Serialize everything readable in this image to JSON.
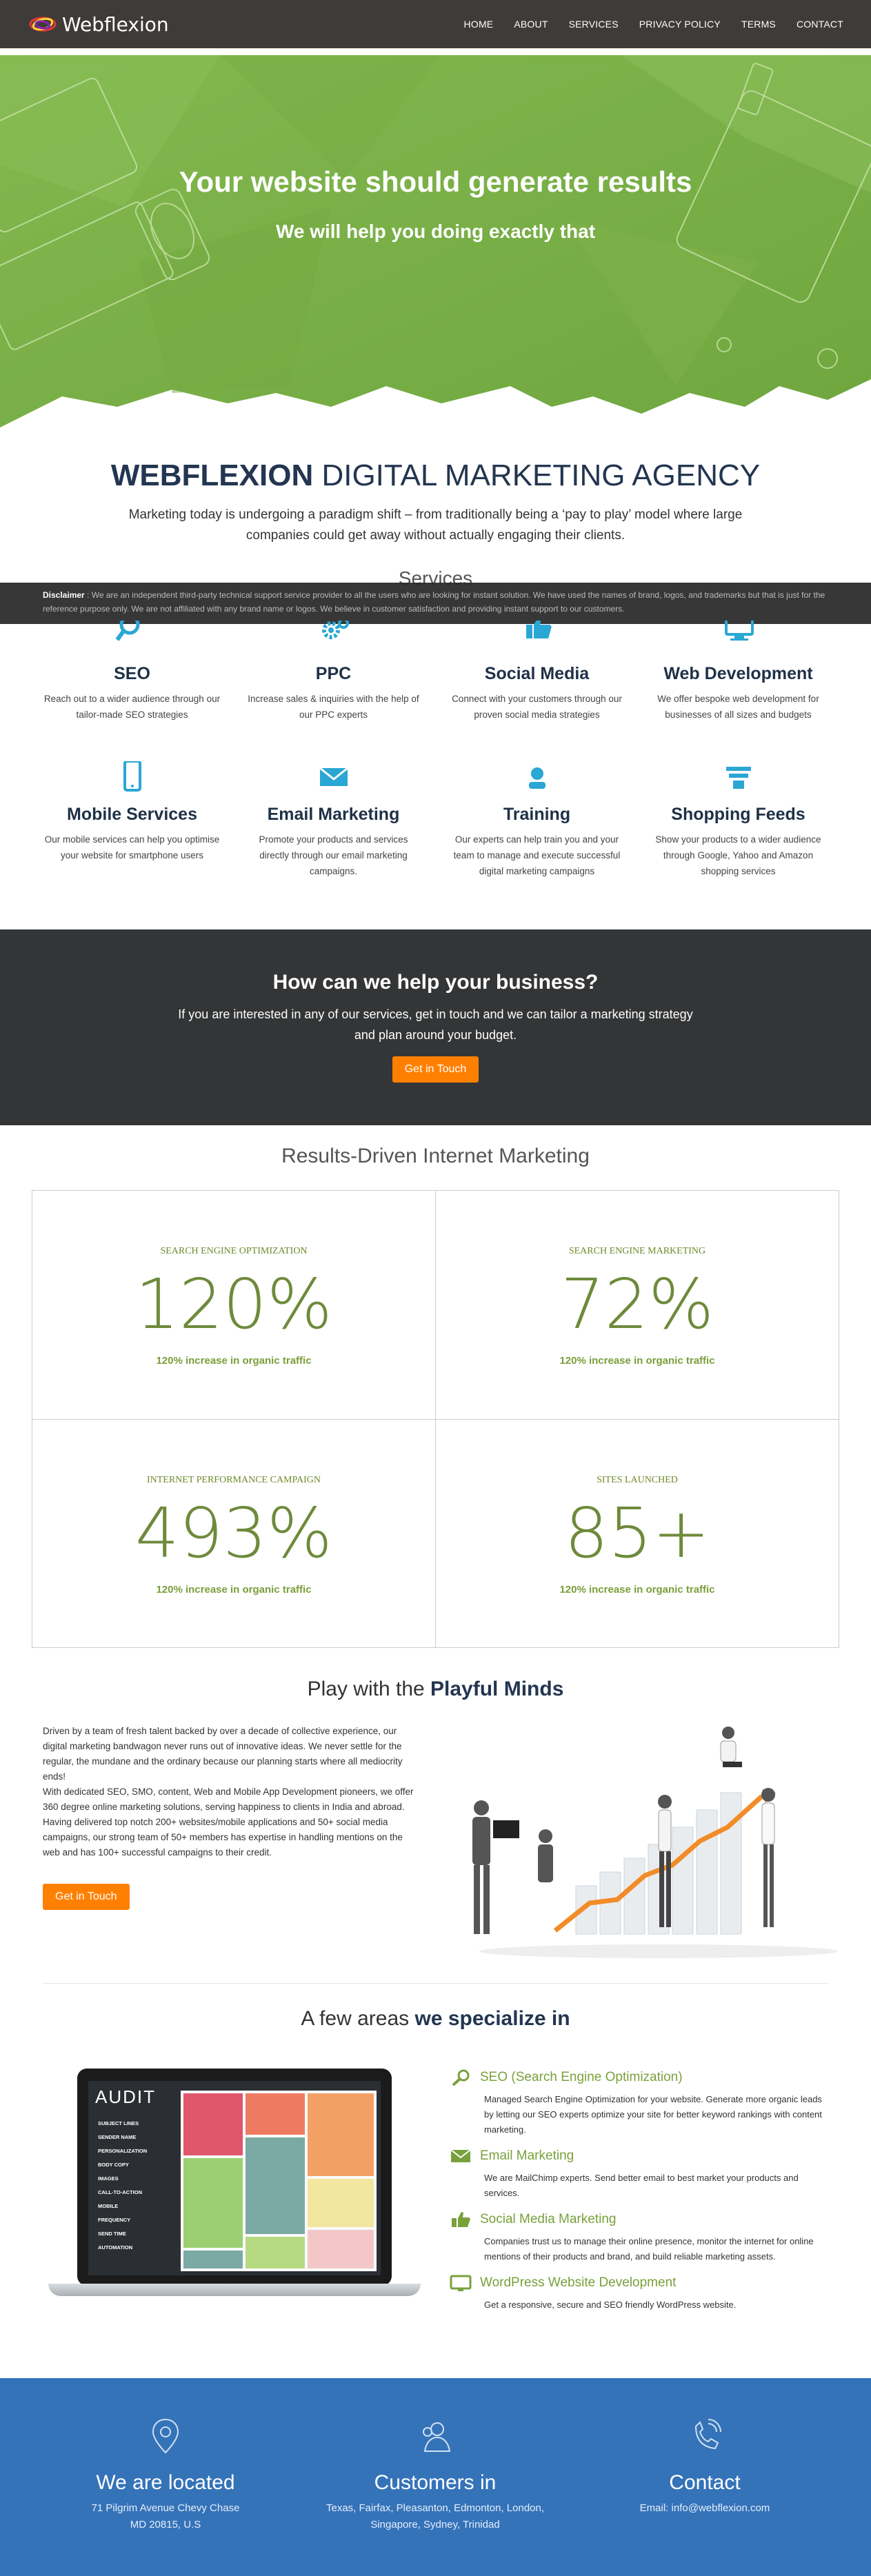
{
  "nav": {
    "brand": "Webflexion",
    "items": [
      {
        "label": "HOME"
      },
      {
        "label": "ABOUT"
      },
      {
        "label": "SERVICES"
      },
      {
        "label": "PRIVACY POLICY"
      },
      {
        "label": "TERMS"
      },
      {
        "label": "CONTACT"
      }
    ]
  },
  "hero": {
    "title": "Your website should generate results",
    "subtitle": "We will help you doing exactly that",
    "color": "#7fb14a"
  },
  "agency": {
    "title_bold": "WEBFLEXION",
    "title_rest": " DIGITAL MARKETING AGENCY",
    "description": "Marketing today is undergoing a paradigm shift – from traditionally being a ‘pay to play’ model where large companies could get away without actually engaging their clients."
  },
  "services_heading": "Services",
  "disclaimer": {
    "label": "Disclaimer",
    "text": " : We are an independent third-party technical support service provider to all the users who are looking for instant solution. We have used the names of brand, logos, and trademarks but that is just for the reference purpose only. We are not affiliated with any brand name or logos. We believe in customer satisfaction and providing instant support to our customers."
  },
  "services": [
    {
      "icon": "magnifier-icon",
      "title": "SEO",
      "text": "Reach out to a wider audience through our tailor-made SEO strategies"
    },
    {
      "icon": "gears-icon",
      "title": "PPC",
      "text": "Increase sales & inquiries with the help of our PPC experts"
    },
    {
      "icon": "thumbs-up-icon",
      "title": "Social Media",
      "text": "Connect with your customers through our proven social media strategies"
    },
    {
      "icon": "monitor-icon",
      "title": "Web Development",
      "text": "We offer bespoke web development for businesses of all sizes and budgets"
    },
    {
      "icon": "mobile-icon",
      "title": "Mobile Services",
      "text": "Our mobile services can help you optimise your website for smartphone users"
    },
    {
      "icon": "envelope-icon",
      "title": "Email Marketing",
      "text": "Promote your products and services directly through our email marketing campaigns."
    },
    {
      "icon": "training-icon",
      "title": "Training",
      "text": "Our experts can help train you and your team to manage and execute successful digital marketing campaigns"
    },
    {
      "icon": "feed-icon",
      "title": "Shopping Feeds",
      "text": "Show your products to a wider audience through Google, Yahoo and Amazon shopping services"
    }
  ],
  "help": {
    "title": "How can we help your business?",
    "text": "If you are interested in any of our services, get in touch and we can tailor a marketing strategy and plan around your budget.",
    "button": "Get in Touch",
    "button_color": "#ff8000"
  },
  "results": {
    "title": "Results-Driven Internet Marketing",
    "stats": [
      {
        "label": "SEARCH ENGINE OPTIMIZATION",
        "value": "120%",
        "sub": "120% increase in organic traffic"
      },
      {
        "label": "SEARCH ENGINE MARKETING",
        "value": "72%",
        "sub": "120% increase in organic traffic"
      },
      {
        "label": "INTERNET PERFORMANCE CAMPAIGN",
        "value": "493%",
        "sub": "120% increase in organic traffic"
      },
      {
        "label": "SITES LAUNCHED",
        "value": "85+",
        "sub": "120% increase in organic traffic"
      }
    ]
  },
  "playful": {
    "title_pre": "Play with the ",
    "title_bold": "Playful Minds",
    "para1": "Driven by a team of fresh talent backed by over a decade of collective experience, our digital marketing bandwagon never runs out of innovative ideas. We never settle for the regular, the mundane and the ordinary because our planning starts where all mediocrity ends!",
    "para2": "With dedicated SEO, SMO, content, Web and Mobile App Development pioneers, we offer 360 degree online marketing solutions, serving happiness to clients in India and abroad. Having delivered top notch 200+ websites/mobile applications and 50+ social media campaigns, our strong team of 50+ members has expertise in handling mentions on the web and has 100+ successful campaigns to their credit.",
    "button": "Get in Touch"
  },
  "specialize": {
    "title_pre": "A few areas ",
    "title_bold": "we specialize in",
    "laptop": {
      "heading": "AUDIT",
      "items": [
        "SUBJECT LINES",
        "SENDER NAME",
        "PERSONALIZATION",
        "BODY COPY",
        "IMAGES",
        "CALL-TO-ACTION",
        "MOBILE",
        "FREQUENCY",
        "SEND TIME",
        "AUTOMATION"
      ]
    },
    "items": [
      {
        "icon": "seo-icon",
        "title": "SEO (Search Engine Optimization)",
        "text": "Managed Search Engine Optimization for your website. Generate more organic leads by letting our SEO experts optimize your site for better keyword rankings with content marketing."
      },
      {
        "icon": "email-icon",
        "title": "Email Marketing",
        "text": "We are MailChimp experts. Send better email to best market your products and services."
      },
      {
        "icon": "social-icon",
        "title": "Social Media Marketing",
        "text": "Companies trust us to manage their online presence, monitor the internet for online mentions of their products and brand, and build reliable marketing assets."
      },
      {
        "icon": "wordpress-icon",
        "title": "WordPress Website Development",
        "text": "Get a responsive, secure and SEO friendly WordPress website."
      }
    ]
  },
  "footer": {
    "color": "#3573b9",
    "located": {
      "title": "We are located",
      "line1": "71 Pilgrim Avenue Chevy Chase",
      "line2": "MD 20815, U.S"
    },
    "customers": {
      "title": "Customers in",
      "line1": "Texas, Fairfax, Pleasanton, Edmonton, London,",
      "line2": "Singapore, Sydney, Trinidad"
    },
    "contact": {
      "title": "Contact",
      "line1": "Email: info@webflexion.com"
    }
  }
}
